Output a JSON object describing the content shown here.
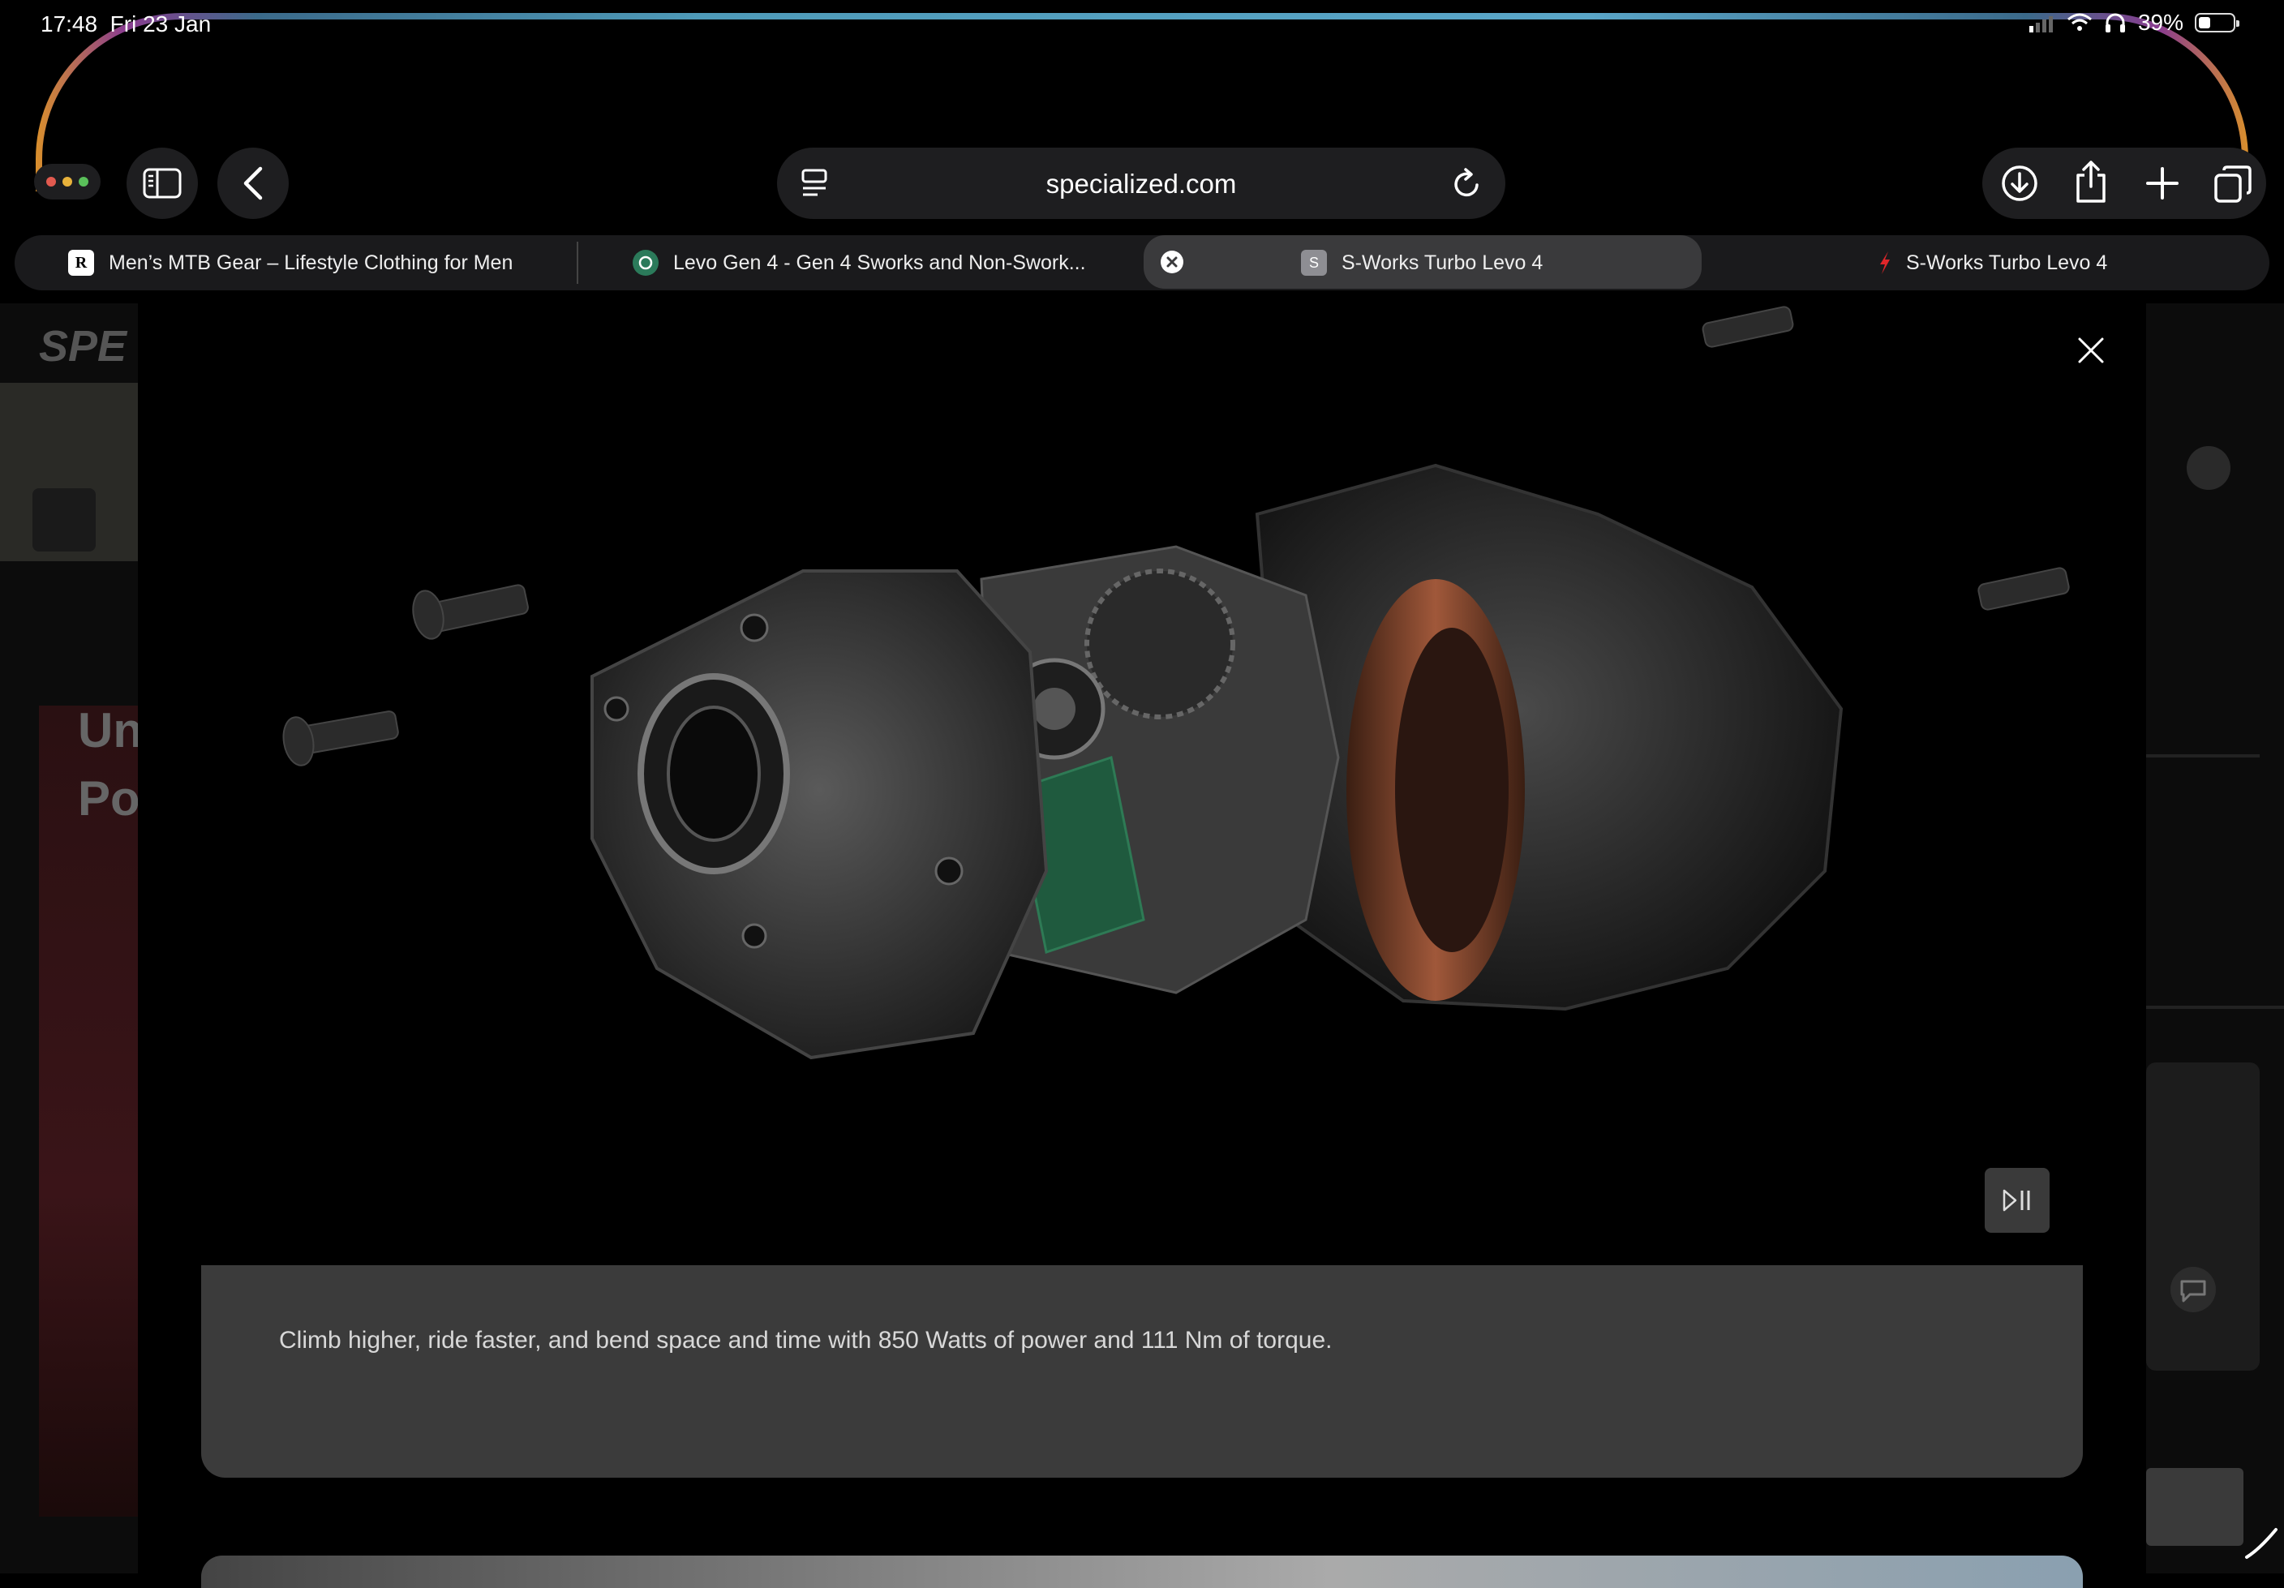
{
  "status_bar": {
    "time": "17:48",
    "date": "Fri 23 Jan",
    "battery": "39%",
    "battery_level": 0.39
  },
  "toolbar": {
    "url": "specialized.com",
    "icons": [
      "window-dots-icon",
      "sidebar-icon",
      "back-chevron-icon",
      "reader-icon",
      "reload-icon",
      "download-icon",
      "share-icon",
      "plus-icon",
      "tabs-icon"
    ]
  },
  "tabs": [
    {
      "label": "Men’s MTB Gear – Lifestyle Clothing for Men",
      "favicon": "R"
    },
    {
      "label": "Levo Gen 4 - Gen 4 Sworks and Non-Swork...",
      "favicon": ""
    },
    {
      "label": "S-Works Turbo Levo 4",
      "favicon": "S",
      "active": true
    },
    {
      "label": "S-Works Turbo Levo 4",
      "favicon": ""
    }
  ],
  "modal": {
    "caption": "Climb higher, ride faster, and bend space and time with 850 Watts of power and 111 Nm of torque."
  },
  "background_page": {
    "logo_partial": "SPE",
    "heading_partial_1": "Un",
    "heading_partial_2": "Po"
  },
  "colors": {
    "accent_red": "#e0262a",
    "caption_bg": "#3b3b3b",
    "toolbar_bg": "#1e1e20"
  }
}
